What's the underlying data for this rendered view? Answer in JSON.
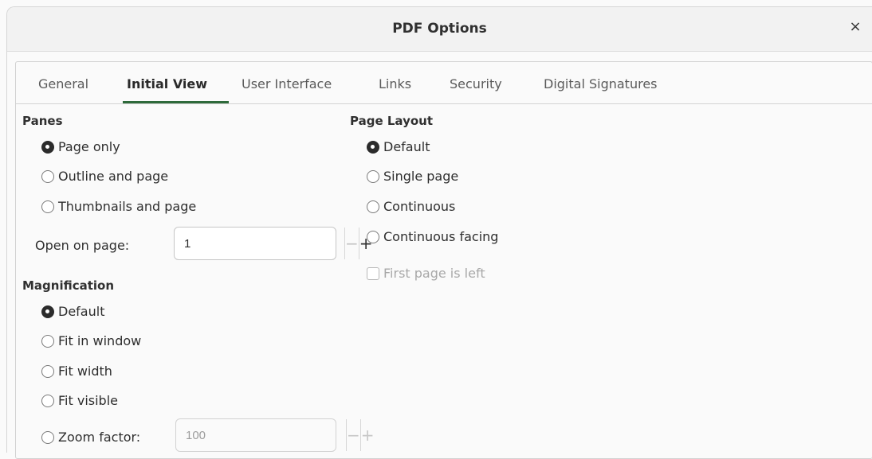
{
  "window": {
    "title": "PDF Options"
  },
  "tabs": [
    {
      "label": "General"
    },
    {
      "label": "Initial View"
    },
    {
      "label": "User Interface"
    },
    {
      "label": "Links"
    },
    {
      "label": "Security"
    },
    {
      "label": "Digital Signatures"
    }
  ],
  "active_tab": "Initial View",
  "panes": {
    "title": "Panes",
    "options": [
      "Page only",
      "Outline and page",
      "Thumbnails and page"
    ],
    "selected": "Page only",
    "open_on_page": {
      "label": "Open on page:",
      "value": "1",
      "minus": "−",
      "plus": "+"
    }
  },
  "magnification": {
    "title": "Magnification",
    "options": [
      "Default",
      "Fit in window",
      "Fit width",
      "Fit visible",
      "Zoom factor:"
    ],
    "selected": "Default",
    "zoom": {
      "value": "100",
      "minus": "−",
      "plus": "+"
    }
  },
  "page_layout": {
    "title": "Page Layout",
    "options": [
      "Default",
      "Single page",
      "Continuous",
      "Continuous facing"
    ],
    "selected": "Default",
    "first_page_left": {
      "label": "First page is left",
      "checked": false,
      "enabled": false
    }
  },
  "icons": {
    "close": "×"
  }
}
